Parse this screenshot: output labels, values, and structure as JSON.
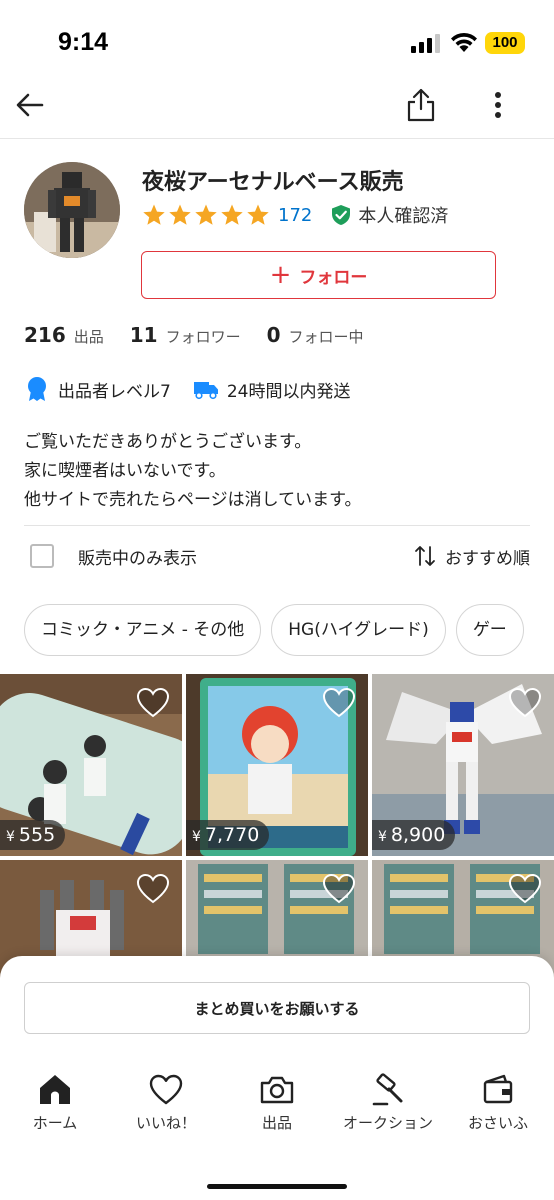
{
  "status_bar": {
    "time": "9:14",
    "battery": "100"
  },
  "shop": {
    "name": "夜桜アーセナルベース販売",
    "review_count": "172",
    "rating_stars": 5,
    "verified_label": "本人確認済"
  },
  "follow_button": {
    "label": "フォロー"
  },
  "stats": [
    {
      "num": "216",
      "label": "出品"
    },
    {
      "num": "11",
      "label": "フォロワー"
    },
    {
      "num": "0",
      "label": "フォロー中"
    }
  ],
  "badges": {
    "level": "出品者レベル7",
    "shipping": "24時間以内発送"
  },
  "bio": [
    "ご覧いただきありがとうございます。",
    "家に喫煙者はいないです。",
    "他サイトで売れたらページは消しています。"
  ],
  "filter": {
    "label": "販売中のみ表示",
    "sort_label": "おすすめ順"
  },
  "chips": [
    "コミック・アニメ - その他",
    "HG(ハイグレード)",
    "ゲー"
  ],
  "items": [
    {
      "price": "555",
      "currency": "¥"
    },
    {
      "price": "7,770",
      "currency": "¥"
    },
    {
      "price": "8,900",
      "currency": "¥"
    },
    {
      "price": "",
      "currency": ""
    },
    {
      "price": "",
      "currency": ""
    },
    {
      "price": "",
      "currency": ""
    }
  ],
  "bulk_button": {
    "label": "まとめ買いをお願いする"
  },
  "tabs": [
    {
      "label": "ホーム",
      "icon": "home-icon"
    },
    {
      "label": "いいね！",
      "icon": "heart-icon"
    },
    {
      "label": "出品",
      "icon": "camera-icon"
    },
    {
      "label": "オークション",
      "icon": "gavel-icon"
    },
    {
      "label": "おさいふ",
      "icon": "wallet-icon"
    }
  ],
  "colors": {
    "accent_red": "#e0363c",
    "star": "#f5a623",
    "link_blue": "#0073cc",
    "verified_green": "#1e9e5a"
  }
}
